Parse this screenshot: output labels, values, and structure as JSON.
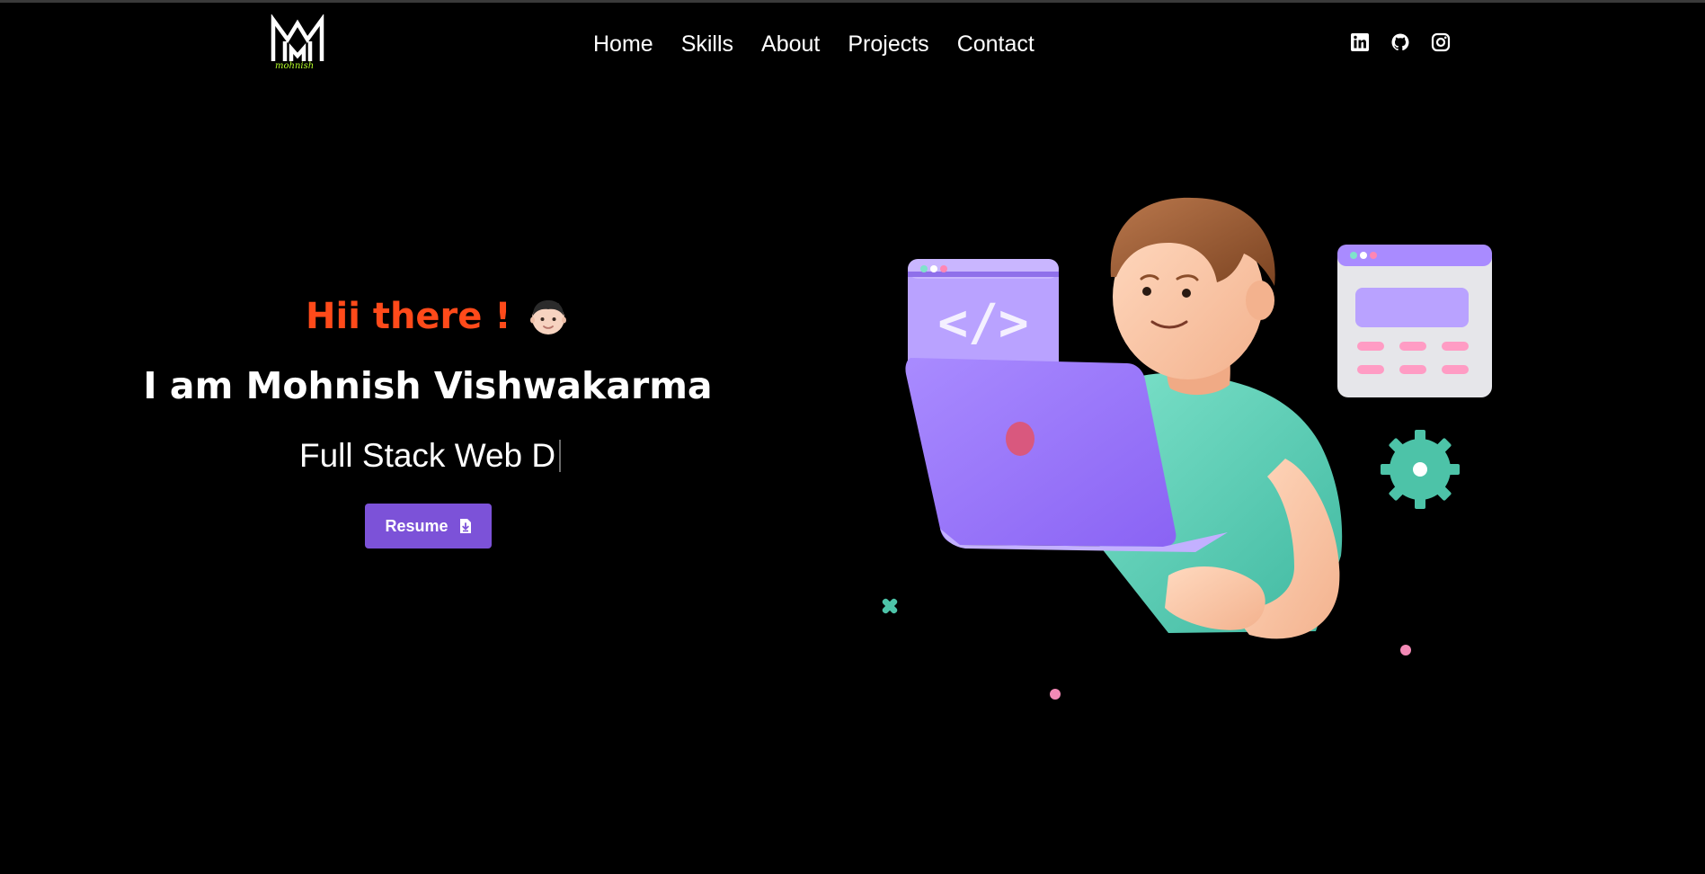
{
  "colors": {
    "background": "#000000",
    "accent": "#7c52d8",
    "greeting": "#ff4a1a",
    "logo_script": "#b6ff2a"
  },
  "header": {
    "logo": {
      "monogram": "MM",
      "script": "mohnish"
    },
    "nav": [
      {
        "label": "Home"
      },
      {
        "label": "Skills"
      },
      {
        "label": "About"
      },
      {
        "label": "Projects"
      },
      {
        "label": "Contact"
      }
    ],
    "socials": [
      {
        "icon": "linkedin-icon"
      },
      {
        "icon": "github-icon"
      },
      {
        "icon": "instagram-icon"
      }
    ]
  },
  "hero": {
    "greeting": "Hii there !",
    "greeting_emoji": "boy-face-icon",
    "name_line": "I am Mohnish Vishwakarma",
    "typing_text": "Full Stack Web D",
    "resume_button": {
      "label": "Resume",
      "icon": "download-file-icon"
    }
  },
  "illustration": {
    "subject": "developer-with-laptop-illustration",
    "code_window_text": "</>"
  }
}
